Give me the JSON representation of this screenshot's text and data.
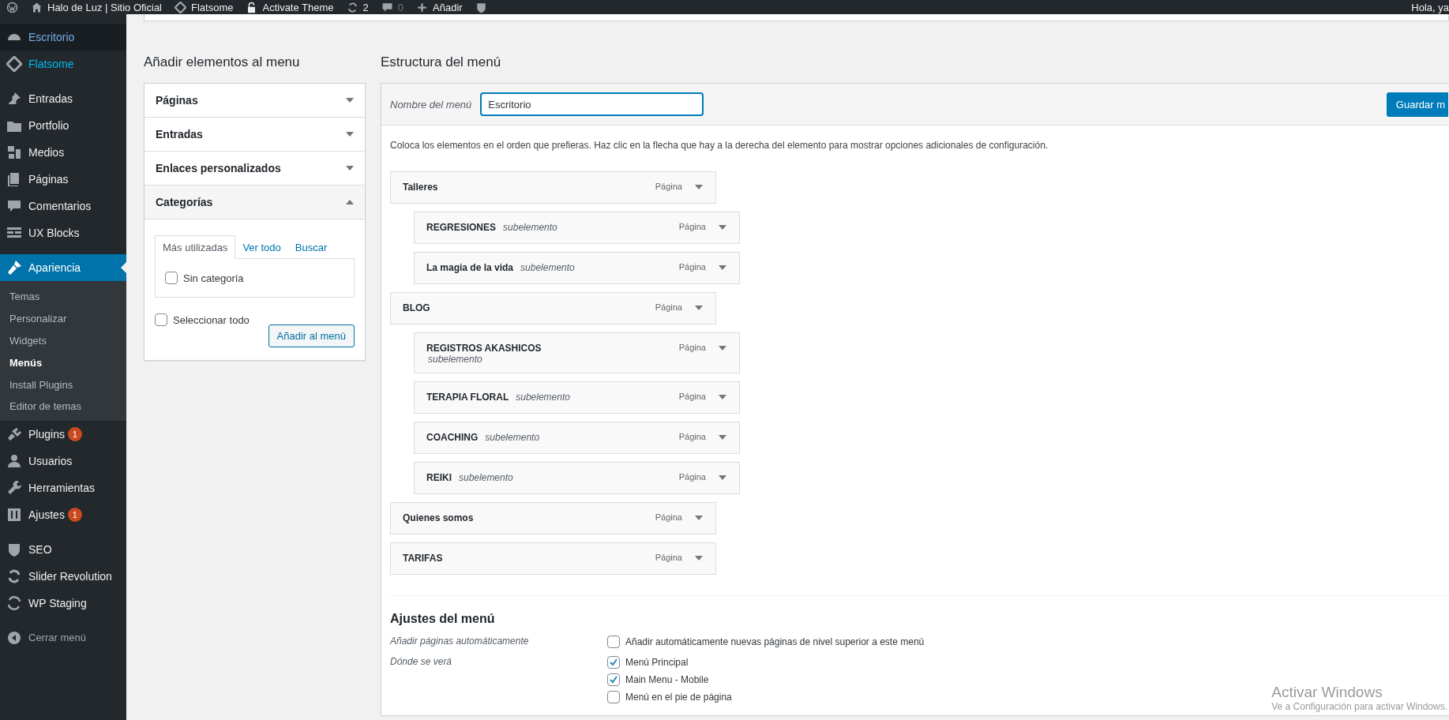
{
  "admin_bar": {
    "site": "Halo de Luz | Sitio Oficial",
    "theme": "Flatsome",
    "activate": "Activate Theme",
    "updates": "2",
    "comments": "0",
    "new": "Añadir",
    "greeting": "Hola, ya"
  },
  "sidebar": {
    "groups": [
      [
        {
          "label": "Escritorio",
          "selected": false,
          "hovered": true
        },
        {
          "label": "Flatsome",
          "selected": false,
          "hovered": false
        }
      ],
      [
        {
          "label": "Entradas",
          "selected": false,
          "hovered": false
        },
        {
          "label": "Portfolio",
          "selected": false,
          "hovered": false
        },
        {
          "label": "Medios",
          "selected": false,
          "hovered": false
        },
        {
          "label": "Páginas",
          "selected": false,
          "hovered": false
        },
        {
          "label": "Comentarios",
          "selected": false,
          "hovered": false
        },
        {
          "label": "UX Blocks",
          "selected": false,
          "hovered": false
        }
      ],
      [
        {
          "label": "Apariencia",
          "selected": true,
          "hovered": false,
          "children": [
            {
              "label": "Temas",
              "selected": false
            },
            {
              "label": "Personalizar",
              "selected": false
            },
            {
              "label": "Widgets",
              "selected": false
            },
            {
              "label": "Menús",
              "selected": true
            },
            {
              "label": "Install Plugins",
              "selected": false
            },
            {
              "label": "Editor de temas",
              "selected": false
            }
          ]
        },
        {
          "label": "Plugins",
          "selected": false,
          "hovered": false,
          "badge": "1"
        },
        {
          "label": "Usuarios",
          "selected": false,
          "hovered": false
        },
        {
          "label": "Herramientas",
          "selected": false,
          "hovered": false
        },
        {
          "label": "Ajustes",
          "selected": false,
          "hovered": false,
          "badge": "1"
        }
      ],
      [
        {
          "label": "SEO",
          "selected": false,
          "hovered": false
        },
        {
          "label": "Slider Revolution",
          "selected": false,
          "hovered": false
        },
        {
          "label": "WP Staging",
          "selected": false,
          "hovered": false
        }
      ]
    ],
    "collapse": "Cerrar menú"
  },
  "add_items": {
    "heading": "Añadir elementos al menu",
    "sections": [
      {
        "title": "Páginas",
        "expanded": false
      },
      {
        "title": "Entradas",
        "expanded": false
      },
      {
        "title": "Enlaces personalizados",
        "expanded": false
      },
      {
        "title": "Categorías",
        "expanded": true
      }
    ],
    "tabs": [
      {
        "label": "Más utilizadas",
        "selected": true
      },
      {
        "label": "Ver todo",
        "selected": false
      },
      {
        "label": "Buscar",
        "selected": false
      }
    ],
    "categories": [
      {
        "label": "Sin categoría",
        "checked": false
      }
    ],
    "select_all": {
      "label": "Seleccionar todo",
      "checked": false
    },
    "button": "Añadir al menú"
  },
  "structure": {
    "heading": "Estructura del menú",
    "name_label": "Nombre del menú",
    "name_value": "Escritorio",
    "save_button": "Guardar m",
    "instructions": "Coloca los elementos en el orden que prefieras. Haz clic en la flecha que hay a la derecha del elemento para mostrar opciones adicionales de configuración.",
    "items": [
      {
        "title": "Talleres",
        "type": "Página",
        "children": [
          {
            "title": "REGRESIONES",
            "note": "subelemento",
            "type": "Página"
          },
          {
            "title": "La magia de la vida",
            "note": "subelemento",
            "type": "Página"
          }
        ]
      },
      {
        "title": "BLOG",
        "type": "Página",
        "children": [
          {
            "title": "REGISTROS AKASHICOS",
            "note": "subelemento",
            "type": "Página"
          },
          {
            "title": "TERAPIA FLORAL",
            "note": "subelemento",
            "type": "Página"
          },
          {
            "title": "COACHING",
            "note": "subelemento",
            "type": "Página"
          },
          {
            "title": "REIKI",
            "note": "subelemento",
            "type": "Página"
          }
        ]
      },
      {
        "title": "Quienes somos",
        "type": "Página"
      },
      {
        "title": "TARIFAS",
        "type": "Página"
      }
    ]
  },
  "settings": {
    "heading": "Ajustes del menú",
    "rows": [
      {
        "label": "Añadir páginas automáticamente",
        "options": [
          {
            "label": "Añadir automáticamente nuevas páginas de nivel superior a este menú",
            "checked": false
          }
        ]
      },
      {
        "label": "Dónde se verá",
        "options": [
          {
            "label": "Menú Principal",
            "checked": true
          },
          {
            "label": "Main Menu - Mobile",
            "checked": true
          },
          {
            "label": "Menú en el pie de página",
            "checked": false
          }
        ]
      }
    ]
  },
  "os_notice": {
    "title": "Activar Windows",
    "subtitle": "Ve a Configuración para activar Windows."
  }
}
